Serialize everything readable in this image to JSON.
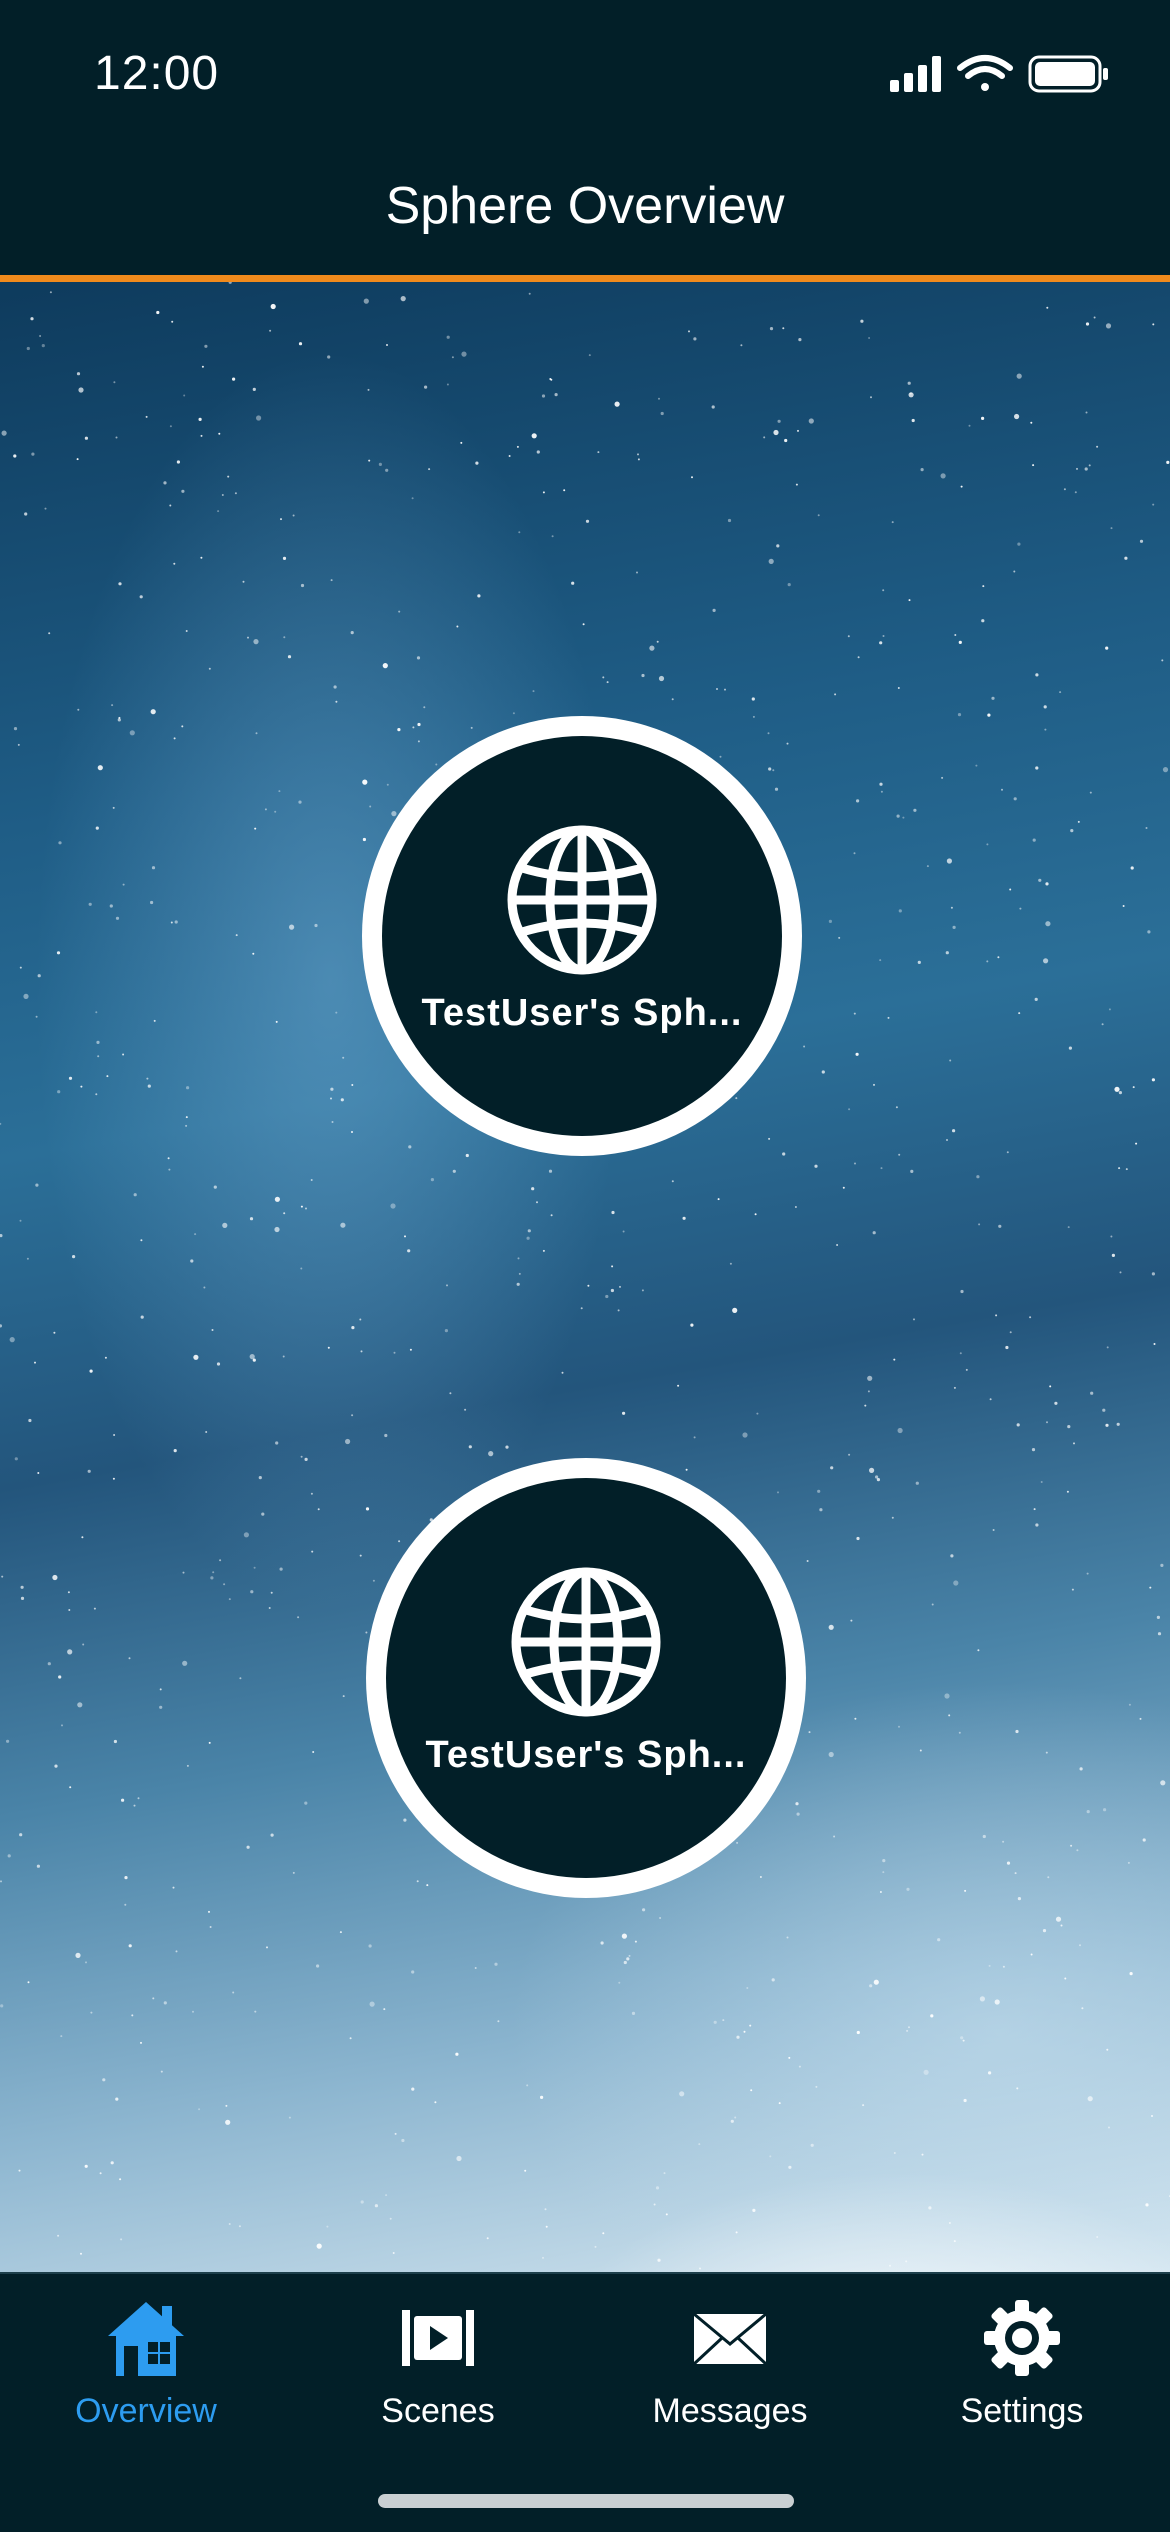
{
  "status_bar": {
    "time": "12:00"
  },
  "header": {
    "title": "Sphere Overview",
    "accent_color": "#f08a1c"
  },
  "spheres": [
    {
      "label": "TestUser's Sph..."
    },
    {
      "label": "TestUser's Sph..."
    }
  ],
  "tabbar": {
    "active_color": "#2d9cf0",
    "items": [
      {
        "label": "Overview",
        "icon": "home-icon",
        "active": true
      },
      {
        "label": "Scenes",
        "icon": "video-icon",
        "active": false
      },
      {
        "label": "Messages",
        "icon": "envelope-icon",
        "active": false
      },
      {
        "label": "Settings",
        "icon": "gear-icon",
        "active": false
      }
    ]
  }
}
